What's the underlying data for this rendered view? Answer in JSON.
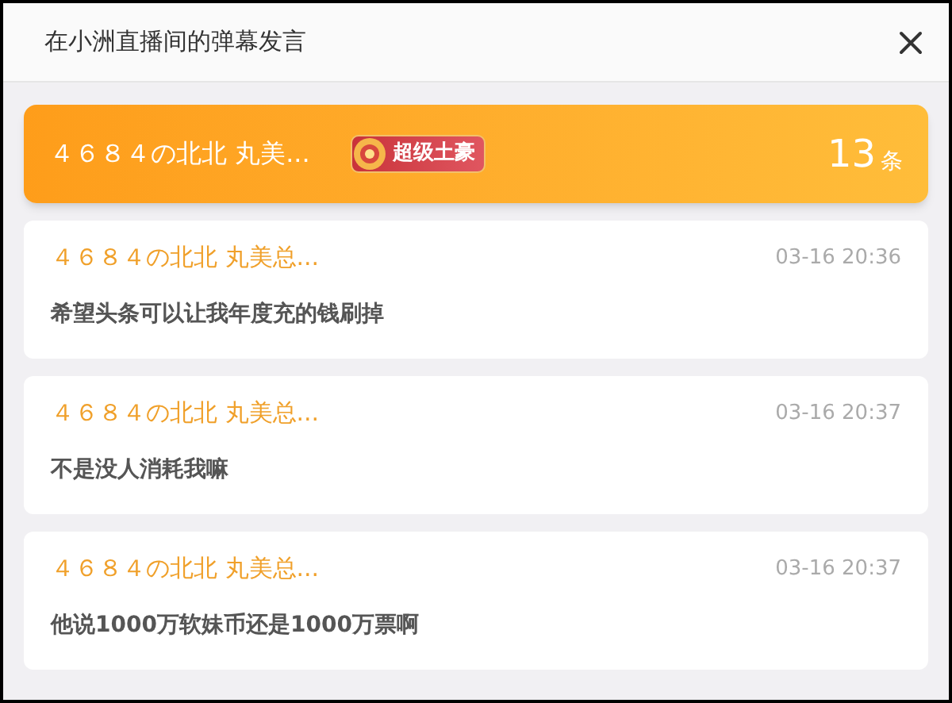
{
  "window": {
    "title": "在小洲直播间的弹幕发言"
  },
  "summary": {
    "name": "４６８４の北北 丸美...",
    "badge": "超级土豪",
    "count": "13",
    "unit": "条"
  },
  "messages": [
    {
      "name": "４６８４の北北 丸美总...",
      "time": "03-16 20:36",
      "text": "希望头条可以让我年度充的钱刷掉"
    },
    {
      "name": "４６８４の北北 丸美总...",
      "time": "03-16 20:37",
      "text": "不是没人消耗我嘛"
    },
    {
      "name": "４６８４の北北 丸美总...",
      "time": "03-16 20:37",
      "text": "他说1000万软妹币还是1000万票啊"
    }
  ]
}
